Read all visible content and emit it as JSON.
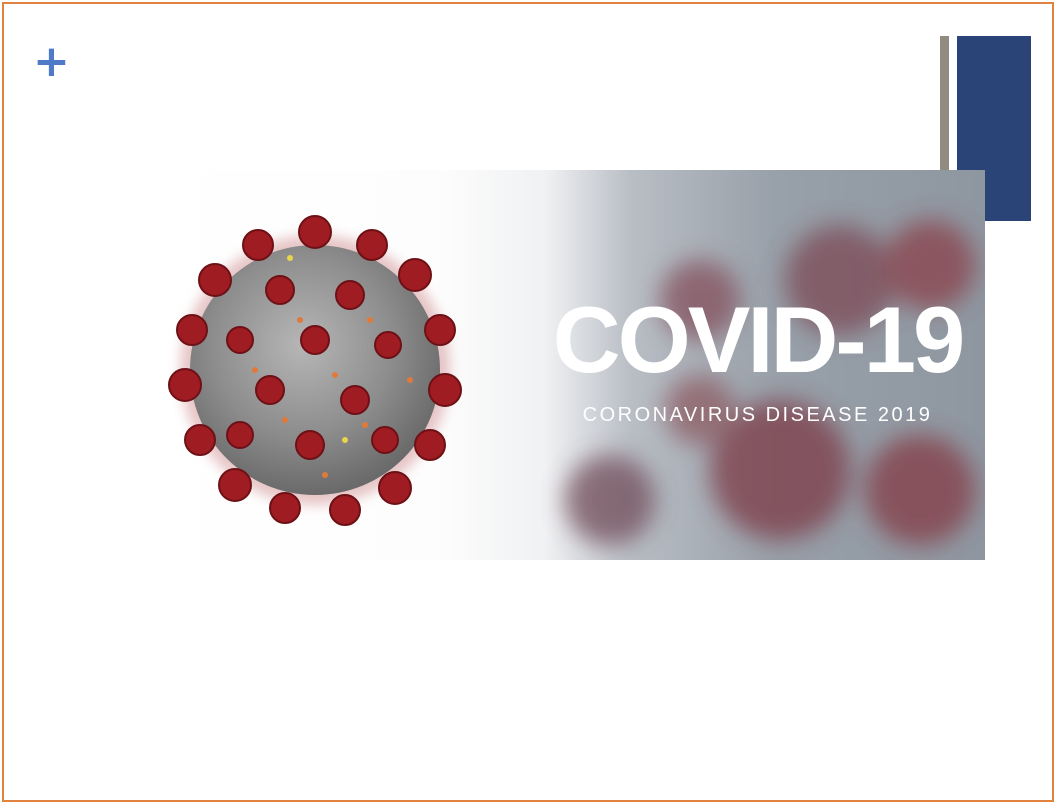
{
  "slide": {
    "plus_symbol": "+",
    "colors": {
      "frame_border": "#e0833f",
      "plus": "#4f7ac7",
      "accent_gray": "#928b80",
      "accent_blue": "#2b4477",
      "virus_spike": "#9e1c22",
      "virus_body": "#8f8f8f"
    }
  },
  "banner": {
    "title": "COVID-19",
    "subtitle": "CORONAVIRUS DISEASE 2019",
    "image": "coronavirus-illustration"
  }
}
